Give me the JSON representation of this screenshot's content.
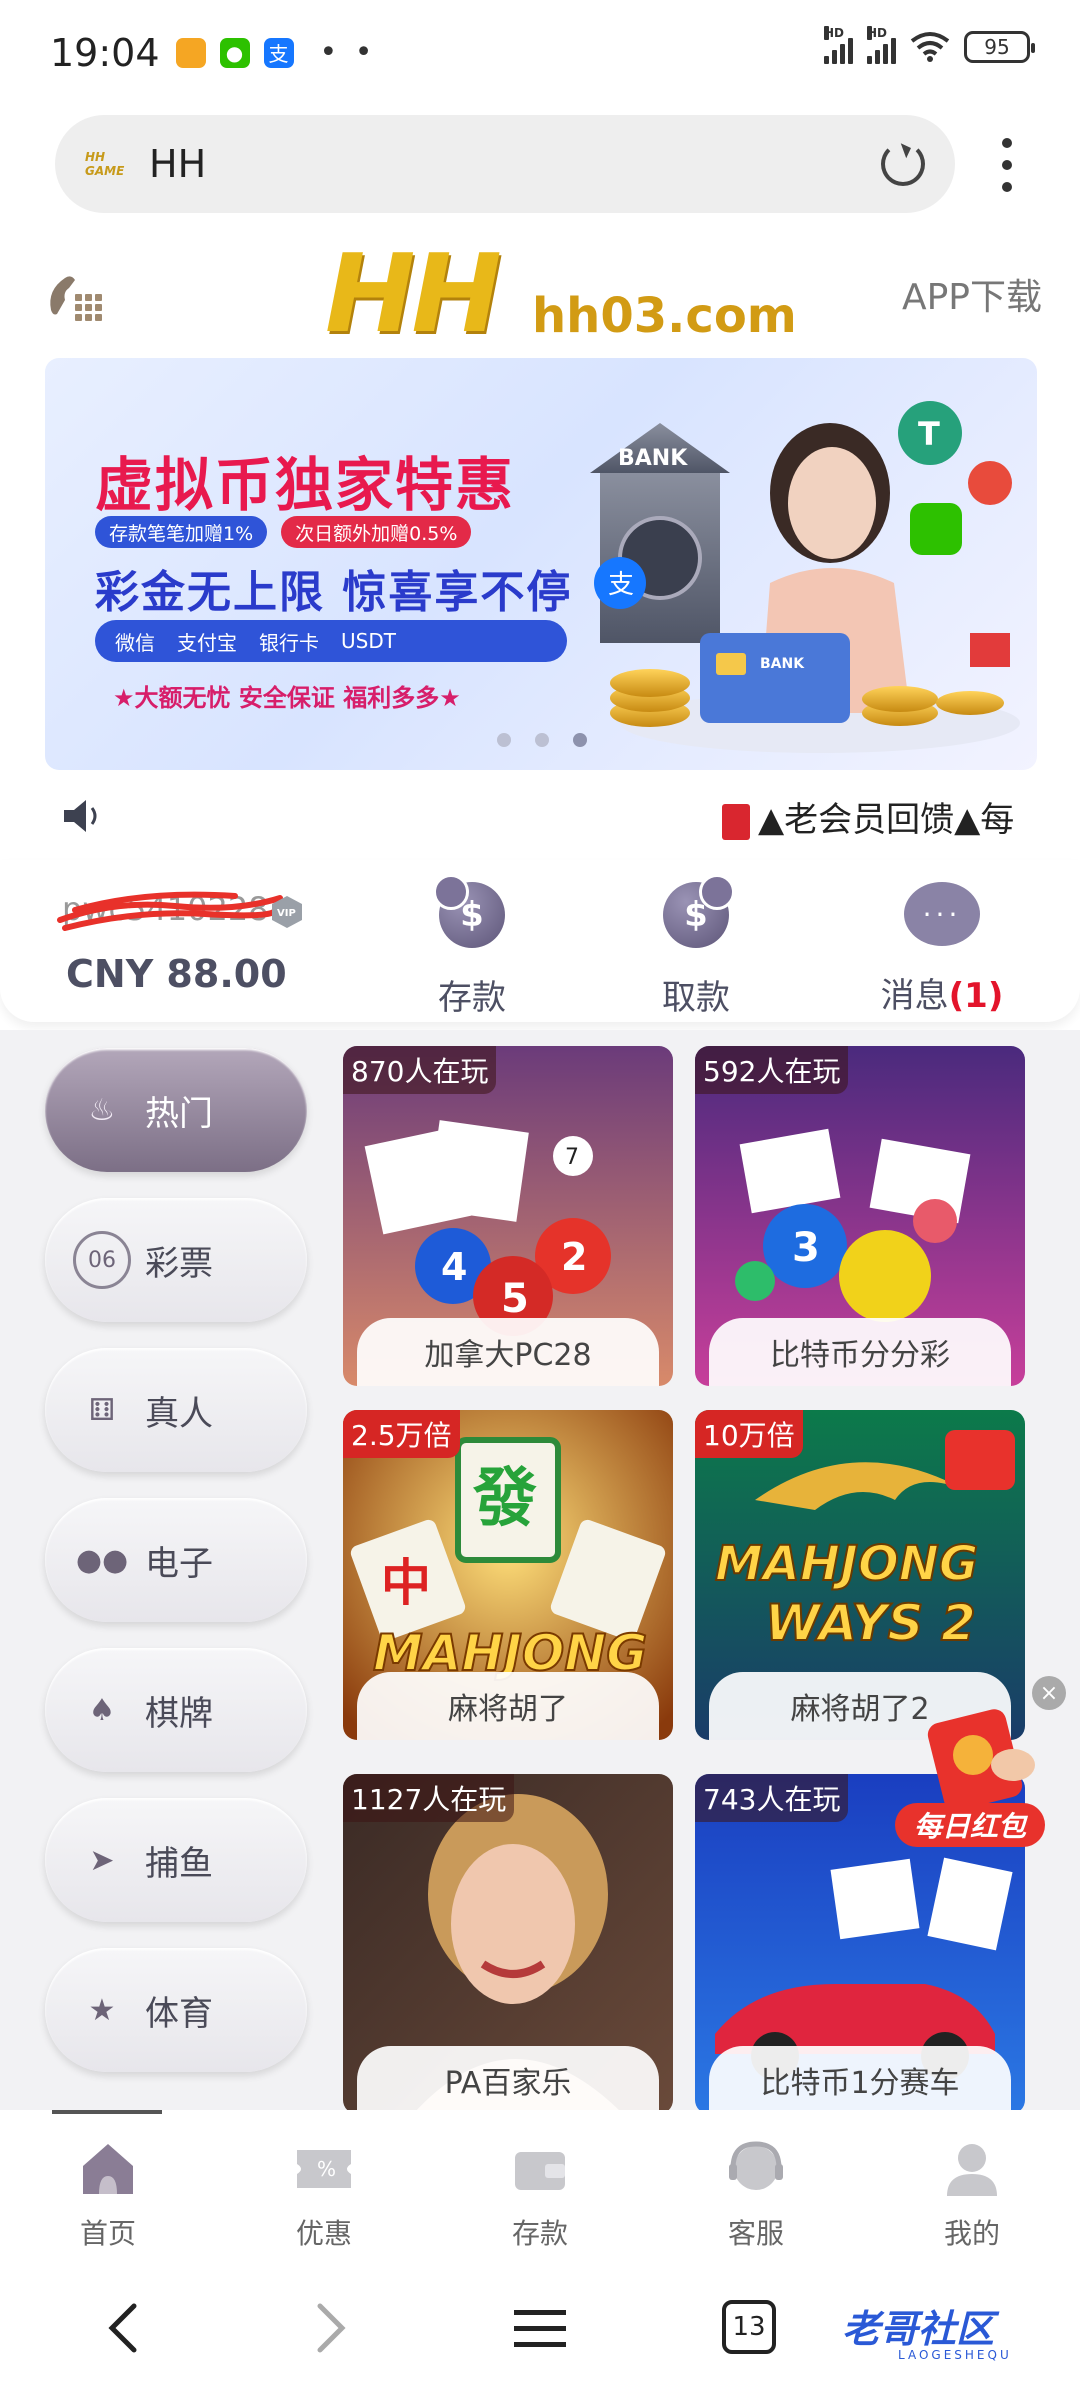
{
  "status_bar": {
    "time": "19:04",
    "apps": [
      {
        "icon": "gallery-app-icon",
        "color": "#f5a623"
      },
      {
        "icon": "wechat-app-icon",
        "color": "#2dc100"
      },
      {
        "icon": "alipay-app-icon",
        "color": "#1677ff",
        "glyph": "支"
      }
    ],
    "more": "• •",
    "signal_label_1": "HD",
    "signal_label_2": "HD",
    "battery": "95"
  },
  "browser": {
    "url": "HH",
    "favicon_text": "HH GAME"
  },
  "header": {
    "logo": "HH",
    "domain": "hh03.com",
    "app_download": "APP下载"
  },
  "banner": {
    "title": "虚拟币独家特惠",
    "pill_1": "存款笔笔加赠1%",
    "pill_2": "次日额外加赠0.5%",
    "subtitle": "彩金无上限 惊喜享不停",
    "pay_methods": [
      "微信",
      "支付宝",
      "银行卡",
      "USDT"
    ],
    "tagline": "★大额无忧 安全保证 福利多多★",
    "bank_label": "BANK",
    "slides_count": 3,
    "active_slide": 2
  },
  "notice": {
    "text": "▲老会员回馈▲每"
  },
  "account": {
    "username": "pwc5410228",
    "balance": "CNY 88.00",
    "deposit_label": "存款",
    "withdraw_label": "取款",
    "messages_label": "消息",
    "messages_count": "(1)"
  },
  "categories": [
    {
      "name": "热门",
      "icon": "flame-icon",
      "active": true
    },
    {
      "name": "彩票",
      "icon": "lottery-ball-icon",
      "active": false
    },
    {
      "name": "真人",
      "icon": "dice-icon",
      "active": false
    },
    {
      "name": "电子",
      "icon": "cherry-icon",
      "active": false
    },
    {
      "name": "棋牌",
      "icon": "playing-cards-icon",
      "active": false
    },
    {
      "name": "捕鱼",
      "icon": "fish-icon",
      "active": false
    },
    {
      "name": "体育",
      "icon": "trophy-icon",
      "active": false
    }
  ],
  "games": [
    {
      "name": "加拿大PC28",
      "badge": "870人在玩",
      "theme": "lottery-balls",
      "colors": [
        "#6b3b7a",
        "#d88a6a"
      ]
    },
    {
      "name": "比特币分分彩",
      "badge": "592人在玩",
      "theme": "bingo",
      "colors": [
        "#4a2a7d",
        "#c73f9a"
      ]
    },
    {
      "name": "麻将胡了",
      "badge": "2.5万倍",
      "theme": "mahjong",
      "colors": [
        "#d99a1a",
        "#8a3a0c"
      ]
    },
    {
      "name": "麻将胡了2",
      "badge": "10万倍",
      "theme": "mahjong-ways-2",
      "colors": [
        "#0c7a4a",
        "#1a3a6a"
      ]
    },
    {
      "name": "PA百家乐",
      "badge": "1127人在玩",
      "theme": "live-dealer",
      "colors": [
        "#3a2a25",
        "#c9a087"
      ]
    },
    {
      "name": "比特币1分赛车",
      "badge": "743人在玩",
      "theme": "racing",
      "colors": [
        "#1a3ec0",
        "#2b78e4"
      ]
    }
  ],
  "red_packet": {
    "label": "每日红包",
    "close": "×"
  },
  "bottom_nav": [
    {
      "label": "首页",
      "icon": "home-icon",
      "active": true
    },
    {
      "label": "优惠",
      "icon": "coupon-icon",
      "active": false
    },
    {
      "label": "存款",
      "icon": "wallet-icon",
      "active": false
    },
    {
      "label": "客服",
      "icon": "customer-service-icon",
      "active": false
    },
    {
      "label": "我的",
      "icon": "profile-icon",
      "active": false
    }
  ],
  "system_nav": {
    "tab_count": "13",
    "watermark": "老哥社区",
    "watermark_sub": "LAOGESHEQU"
  },
  "colors": {
    "accent_purple": "#7c6f86",
    "logo_gold": "#e8b819",
    "alert_red": "#e3142b"
  }
}
